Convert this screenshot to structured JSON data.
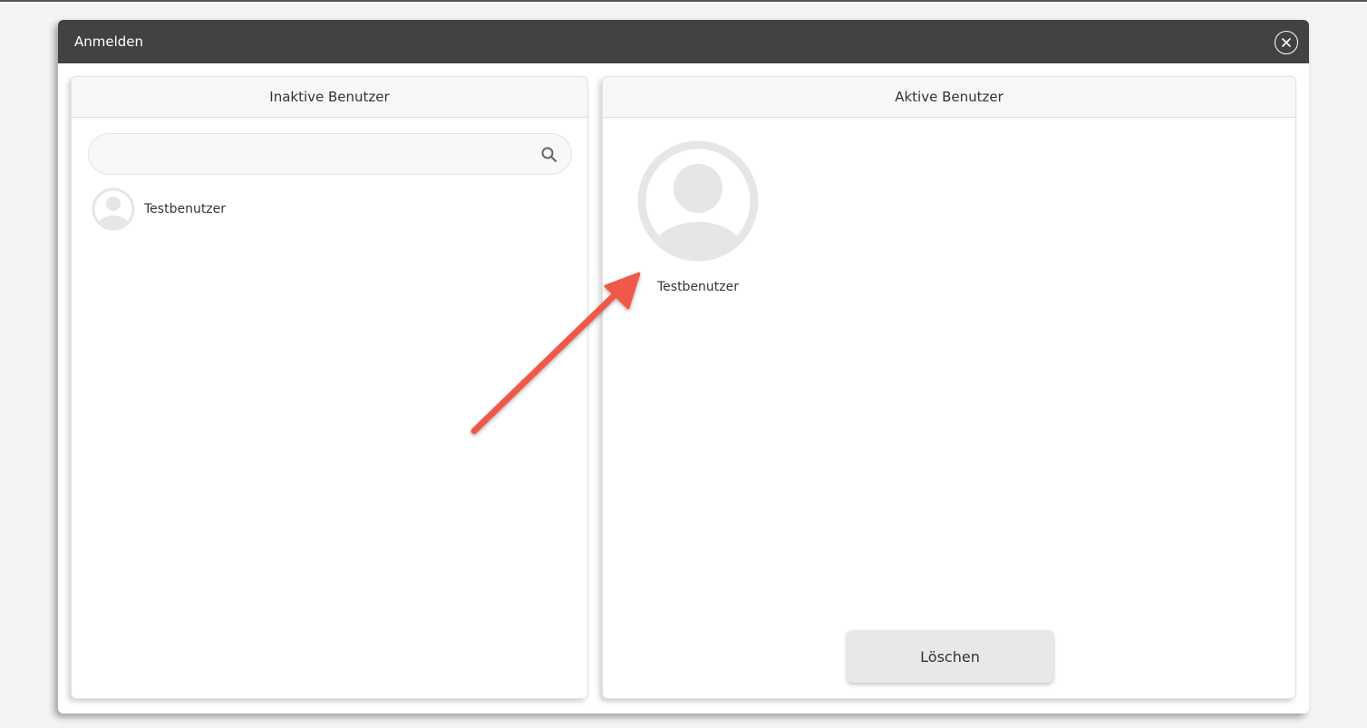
{
  "dialog": {
    "title": "Anmelden",
    "close_icon": "close-circle-icon"
  },
  "inactive": {
    "header": "Inaktive Benutzer",
    "search": {
      "value": "",
      "placeholder": "",
      "icon": "search-icon"
    },
    "users": [
      {
        "name": "Testbenutzer",
        "icon": "avatar-icon"
      }
    ]
  },
  "active": {
    "header": "Aktive Benutzer",
    "users": [
      {
        "name": "Testbenutzer",
        "icon": "avatar-icon"
      }
    ],
    "delete_label": "Löschen"
  },
  "annotation": {
    "icon": "arrow-icon",
    "color": "#f0584a"
  },
  "colors": {
    "titlebar": "#424242",
    "avatar": "#e6e6e6"
  }
}
